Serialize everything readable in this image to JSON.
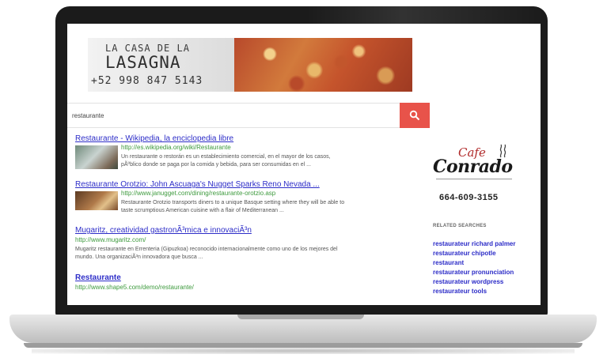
{
  "banner": {
    "name_line1": "LA CASA DE LA",
    "name_line2": "LASAGNA",
    "phone": "+52 998 847 5143"
  },
  "search": {
    "query": "restaurante"
  },
  "results": [
    {
      "title": "Restaurante - Wikipedia, la enciclopedia libre",
      "url": "http://es.wikipedia.org/wiki/Restaurante",
      "snippet1": "Un restaurante o restorán es un establecimiento comercial, en el mayor de los casos,",
      "snippet2": "pÃºblico donde se paga por la comida y bebida, para ser consumidas en el ..."
    },
    {
      "title": "Restaurante Orotzio: John Ascuaga's Nugget Sparks Reno Nevada ...",
      "url": "http://www.janugget.com/dining/restaurante-orotzio.asp",
      "snippet1": "Restaurante Orotzio transports diners to a unique Basque setting where they will be able to",
      "snippet2": "taste scrumptious American cuisine with a flair of Mediterranean ..."
    },
    {
      "title": "Mugaritz, creatividad gastronÃ³mica e innovaciÃ³n",
      "url": "http://www.mugaritz.com/",
      "snippet1": "Mugaritz restaurante en Errenteria (Gipuzkoa) reconocido internacionalmente como uno de los mejores del",
      "snippet2": "mundo. Una organizaciÃ³n innovadora que busca ..."
    },
    {
      "title": "Restaurante",
      "url": "http://www.shape5.com/demo/restaurante/"
    }
  ],
  "sidebar": {
    "logo_cafe": "Cafe",
    "logo_name": "Conrado",
    "phone": "664-609-3155",
    "related_title": "RELATED SEARCHES",
    "related": [
      "restaurateur richard palmer",
      "restaurateur chipotle",
      "restaurant",
      "restaurateur pronunciation",
      "restaurateur wordpress",
      "restaurateur tools"
    ]
  },
  "colors": {
    "search_button": "#e8534a",
    "link": "#2d2dc8",
    "url": "#3d9a3d",
    "logo_accent": "#b02a2a"
  },
  "icons": {
    "search": "search-icon",
    "steam": "steam-icon"
  }
}
